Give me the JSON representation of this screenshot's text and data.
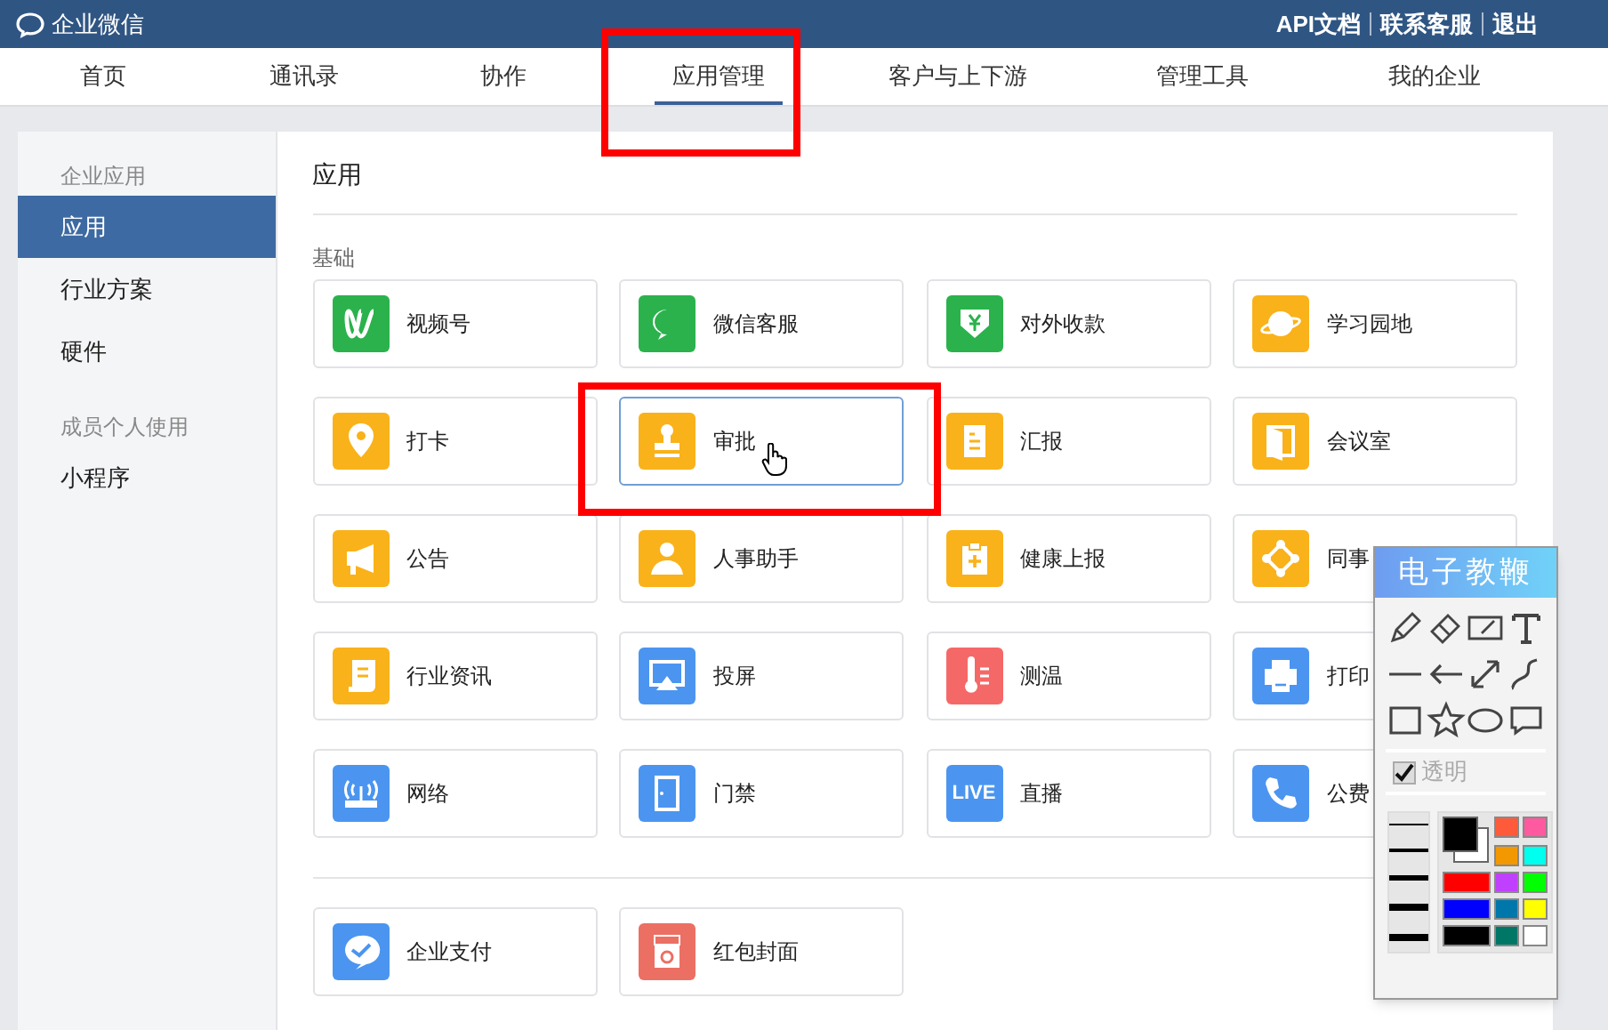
{
  "top_bar": {
    "brand": "企业微信",
    "links": [
      "API文档",
      "联系客服",
      "退出"
    ]
  },
  "nav_tabs": [
    {
      "label": "首页",
      "selected": false
    },
    {
      "label": "通讯录",
      "selected": false
    },
    {
      "label": "协作",
      "selected": false
    },
    {
      "label": "应用管理",
      "selected": true
    },
    {
      "label": "客户与上下游",
      "selected": false
    },
    {
      "label": "管理工具",
      "selected": false
    },
    {
      "label": "我的企业",
      "selected": false
    }
  ],
  "sidebar": {
    "groups": [
      {
        "label": "企业应用",
        "items": [
          {
            "label": "应用",
            "selected": true
          },
          {
            "label": "行业方案",
            "selected": false
          },
          {
            "label": "硬件",
            "selected": false
          }
        ]
      },
      {
        "label": "成员个人使用",
        "items": [
          {
            "label": "小程序",
            "selected": false
          }
        ]
      }
    ]
  },
  "main": {
    "title": "应用",
    "sections": [
      {
        "label": "基础",
        "apps": [
          {
            "name": "视频号",
            "color": "#2bb24c",
            "selected": false
          },
          {
            "name": "微信客服",
            "color": "#2bb24c",
            "selected": false
          },
          {
            "name": "对外收款",
            "color": "#2bb24c",
            "selected": false
          },
          {
            "name": "学习园地",
            "color": "#f9b21a",
            "selected": false
          },
          {
            "name": "打卡",
            "color": "#f9b21a",
            "selected": false
          },
          {
            "name": "审批",
            "color": "#f9b21a",
            "selected": true
          },
          {
            "name": "汇报",
            "color": "#f9b21a",
            "selected": false
          },
          {
            "name": "会议室",
            "color": "#f9b21a",
            "selected": false
          },
          {
            "name": "公告",
            "color": "#f9b21a",
            "selected": false
          },
          {
            "name": "人事助手",
            "color": "#f9b21a",
            "selected": false
          },
          {
            "name": "健康上报",
            "color": "#f9b21a",
            "selected": false
          },
          {
            "name": "同事",
            "color": "#f9b21a",
            "selected": false
          },
          {
            "name": "行业资讯",
            "color": "#f9b21a",
            "selected": false
          },
          {
            "name": "投屏",
            "color": "#4b95f0",
            "selected": false
          },
          {
            "name": "测温",
            "color": "#f56868",
            "selected": false
          },
          {
            "name": "打印",
            "color": "#4b95f0",
            "selected": false
          },
          {
            "name": "网络",
            "color": "#4b95f0",
            "selected": false
          },
          {
            "name": "门禁",
            "color": "#4b95f0",
            "selected": false
          },
          {
            "name": "直播",
            "color": "#4b95f0",
            "selected": false,
            "icon_text": "LIVE"
          },
          {
            "name": "公费",
            "color": "#4b95f0",
            "selected": false
          }
        ]
      },
      {
        "apps": [
          {
            "name": "企业支付",
            "color": "#4b95f0",
            "selected": false
          },
          {
            "name": "红包封面",
            "color": "#ec6f64",
            "selected": false
          }
        ]
      }
    ]
  },
  "pointer_tool": {
    "title": "电子教鞭",
    "transparent": {
      "label": "透明",
      "checked": true
    },
    "colors": [
      {
        "color": "#ff5b3a"
      },
      {
        "color": "#ff5aa0"
      },
      {
        "color": "#f39800"
      },
      {
        "color": "#00ffee"
      },
      {
        "color": "#ff0000"
      },
      {
        "color": "#c040ff"
      },
      {
        "color": "#00ff00"
      },
      {
        "color": "#0000ff"
      },
      {
        "color": "#0077aa"
      },
      {
        "color": "#ffff00"
      },
      {
        "color": "#000000"
      },
      {
        "color": "#007766"
      },
      {
        "color": "#ffffff"
      }
    ]
  }
}
